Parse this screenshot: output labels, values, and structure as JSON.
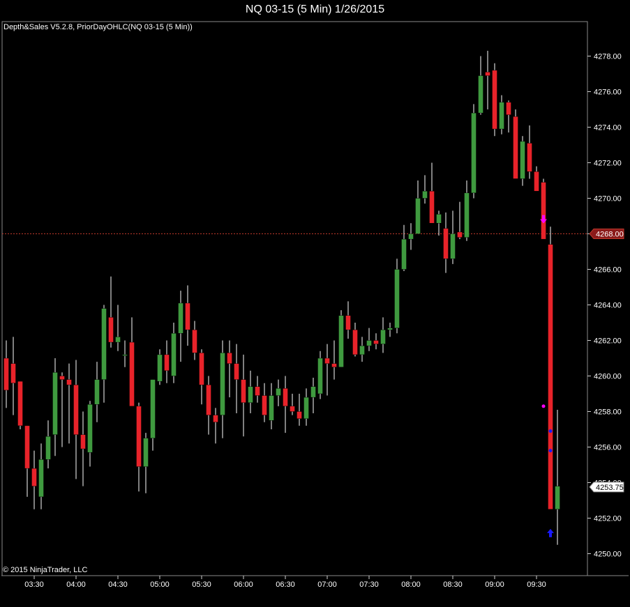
{
  "window": {
    "title": "NQ 03-15 (5 Min)  1/26/2015"
  },
  "indicators_label": "Depth&Sales V5.2.8, PriorDayOHLC(NQ 03-15 (5 Min))",
  "copyright": "© 2015 NinjaTrader, LLC",
  "colors": {
    "background": "#000000",
    "up": "#3f9a3f",
    "down": "#e8232a",
    "wick": "#ffffff",
    "prior_level": "#c0392b",
    "marker_down": "#ff00ff",
    "marker_up": "#1a1aff"
  },
  "chart_data": {
    "type": "candlestick",
    "instrument": "NQ 03-15",
    "interval": "5 Min",
    "y_ticks": [
      "4278.00",
      "4276.00",
      "4274.00",
      "4272.00",
      "4270.00",
      "4268.00",
      "4266.00",
      "4264.00",
      "4262.00",
      "4260.00",
      "4258.00",
      "4256.00",
      "4254.00",
      "4252.00",
      "4250.00"
    ],
    "x_ticks": [
      "03:30",
      "04:00",
      "04:30",
      "05:00",
      "05:30",
      "06:00",
      "06:30",
      "07:00",
      "07:30",
      "08:00",
      "08:30",
      "09:00",
      "09:30"
    ],
    "ylim": [
      4249.0,
      4280.0
    ],
    "prior_level": {
      "value": 4268.0,
      "label": "4268.00"
    },
    "last_price": {
      "value": 4253.75,
      "label": "4253.75"
    },
    "candles": [
      [
        4261.0,
        4262.0,
        4258.2,
        4259.2
      ],
      [
        4260.7,
        4262.2,
        4257.8,
        4259.6
      ],
      [
        4259.7,
        4259.7,
        4257.0,
        4257.2
      ],
      [
        4257.2,
        4257.2,
        4253.2,
        4254.8
      ],
      [
        4254.8,
        4255.8,
        4252.5,
        4253.8
      ],
      [
        4253.2,
        4256.2,
        4252.5,
        4255.3
      ],
      [
        4255.3,
        4257.5,
        4254.8,
        4256.6
      ],
      [
        4256.7,
        4261.0,
        4255.5,
        4260.2
      ],
      [
        4260.0,
        4260.2,
        4256.0,
        4259.8
      ],
      [
        4259.8,
        4260.7,
        4256.2,
        4259.5
      ],
      [
        4259.5,
        4260.9,
        4254.2,
        4256.7
      ],
      [
        4256.7,
        4258.0,
        4253.8,
        4255.9
      ],
      [
        4255.7,
        4258.6,
        4254.9,
        4258.4
      ],
      [
        4258.4,
        4260.8,
        4257.4,
        4259.8
      ],
      [
        4259.8,
        4264.0,
        4258.5,
        4263.8
      ],
      [
        4263.3,
        4265.6,
        4261.6,
        4261.9
      ],
      [
        4261.9,
        4264.0,
        4261.4,
        4262.2
      ],
      [
        4261.2,
        4262.0,
        4260.5,
        4261.2
      ],
      [
        4261.9,
        4263.3,
        4258.5,
        4258.3
      ],
      [
        4258.3,
        4258.5,
        4253.5,
        4254.9
      ],
      [
        4254.9,
        4256.8,
        4253.4,
        4256.5
      ],
      [
        4256.5,
        4259.8,
        4255.8,
        4259.8
      ],
      [
        4259.7,
        4261.5,
        4259.5,
        4261.2
      ],
      [
        4261.2,
        4262.0,
        4259.6,
        4260.3
      ],
      [
        4260.0,
        4263.0,
        4259.6,
        4262.4
      ],
      [
        4262.4,
        4264.8,
        4260.8,
        4264.1
      ],
      [
        4264.1,
        4265.1,
        4261.7,
        4262.6
      ],
      [
        4262.6,
        4263.1,
        4260.9,
        4261.3
      ],
      [
        4261.3,
        4261.5,
        4258.4,
        4259.5
      ],
      [
        4259.5,
        4260.0,
        4256.7,
        4257.8
      ],
      [
        4257.8,
        4258.2,
        4256.2,
        4257.4
      ],
      [
        4257.8,
        4262.0,
        4256.5,
        4261.3
      ],
      [
        4261.3,
        4262.0,
        4258.8,
        4260.7
      ],
      [
        4260.7,
        4261.8,
        4257.9,
        4259.8
      ],
      [
        4259.8,
        4261.2,
        4256.6,
        4258.5
      ],
      [
        4258.5,
        4260.3,
        4257.9,
        4259.4
      ],
      [
        4259.4,
        4260.0,
        4258.5,
        4258.9
      ],
      [
        4258.9,
        4259.6,
        4257.4,
        4257.8
      ],
      [
        4257.5,
        4259.6,
        4257.0,
        4258.9
      ],
      [
        4258.9,
        4259.8,
        4258.3,
        4259.3
      ],
      [
        4259.3,
        4260.0,
        4256.8,
        4258.3
      ],
      [
        4258.3,
        4259.0,
        4257.8,
        4258.0
      ],
      [
        4258.0,
        4259.0,
        4257.2,
        4257.6
      ],
      [
        4257.6,
        4259.3,
        4257.2,
        4258.8
      ],
      [
        4258.8,
        4259.9,
        4257.9,
        4259.4
      ],
      [
        4259.0,
        4261.4,
        4258.7,
        4261.0
      ],
      [
        4261.0,
        4261.8,
        4258.9,
        4260.7
      ],
      [
        4260.7,
        4262.0,
        4259.8,
        4260.5
      ],
      [
        4260.5,
        4263.7,
        4260.5,
        4263.4
      ],
      [
        4263.4,
        4264.2,
        4262.1,
        4262.6
      ],
      [
        4262.6,
        4263.0,
        4261.1,
        4261.2
      ],
      [
        4261.2,
        4262.2,
        4260.8,
        4261.7
      ],
      [
        4261.7,
        4262.7,
        4261.4,
        4262.0
      ],
      [
        4262.0,
        4262.4,
        4261.5,
        4261.8
      ],
      [
        4261.8,
        4263.3,
        4261.3,
        4262.6
      ],
      [
        4262.6,
        4263.0,
        4262.2,
        4262.7
      ],
      [
        4262.7,
        4266.6,
        4262.4,
        4266.0
      ],
      [
        4266.0,
        4268.5,
        4265.9,
        4267.7
      ],
      [
        4267.7,
        4268.6,
        4267.1,
        4268.0
      ],
      [
        4268.0,
        4271.0,
        4268.0,
        4270.0
      ],
      [
        4270.0,
        4271.3,
        4269.7,
        4270.4
      ],
      [
        4270.4,
        4272.0,
        4269.2,
        4268.6
      ],
      [
        4268.6,
        4269.3,
        4267.9,
        4269.1
      ],
      [
        4268.3,
        4269.2,
        4265.8,
        4266.6
      ],
      [
        4266.6,
        4269.3,
        4266.3,
        4268.0
      ],
      [
        4268.1,
        4269.8,
        4267.7,
        4267.8
      ],
      [
        4267.8,
        4271.0,
        4267.6,
        4270.3
      ],
      [
        4270.3,
        4275.3,
        4270.0,
        4274.8
      ],
      [
        4274.8,
        4278.0,
        4274.7,
        4276.9
      ],
      [
        4277.1,
        4278.3,
        4275.0,
        4276.9
      ],
      [
        4277.2,
        4277.6,
        4273.5,
        4273.9
      ],
      [
        4273.9,
        4275.8,
        4273.6,
        4275.4
      ],
      [
        4275.4,
        4275.5,
        4273.7,
        4274.7
      ],
      [
        4274.6,
        4275.0,
        4271.8,
        4271.1
      ],
      [
        4271.1,
        4273.5,
        4270.7,
        4273.2
      ],
      [
        4273.1,
        4274.1,
        4271.1,
        4271.5
      ],
      [
        4271.5,
        4271.8,
        4270.4,
        4270.4
      ],
      [
        4270.9,
        4271.1,
        4268.8,
        4267.7
      ],
      [
        4267.4,
        4268.4,
        4266.6,
        4252.5
      ],
      [
        4252.5,
        4258.1,
        4250.5,
        4253.8
      ]
    ],
    "markers": [
      {
        "candle": 77,
        "type": "sell-arrow",
        "value": 4268.7
      },
      {
        "candle": 78,
        "type": "buy-arrow",
        "value": 4251.2
      },
      {
        "candle": 77,
        "type": "dot",
        "value": 4258.3
      },
      {
        "candle": 78,
        "type": "dot",
        "value": 4256.9
      },
      {
        "candle": 78,
        "type": "dot",
        "value": 4255.8
      }
    ]
  }
}
